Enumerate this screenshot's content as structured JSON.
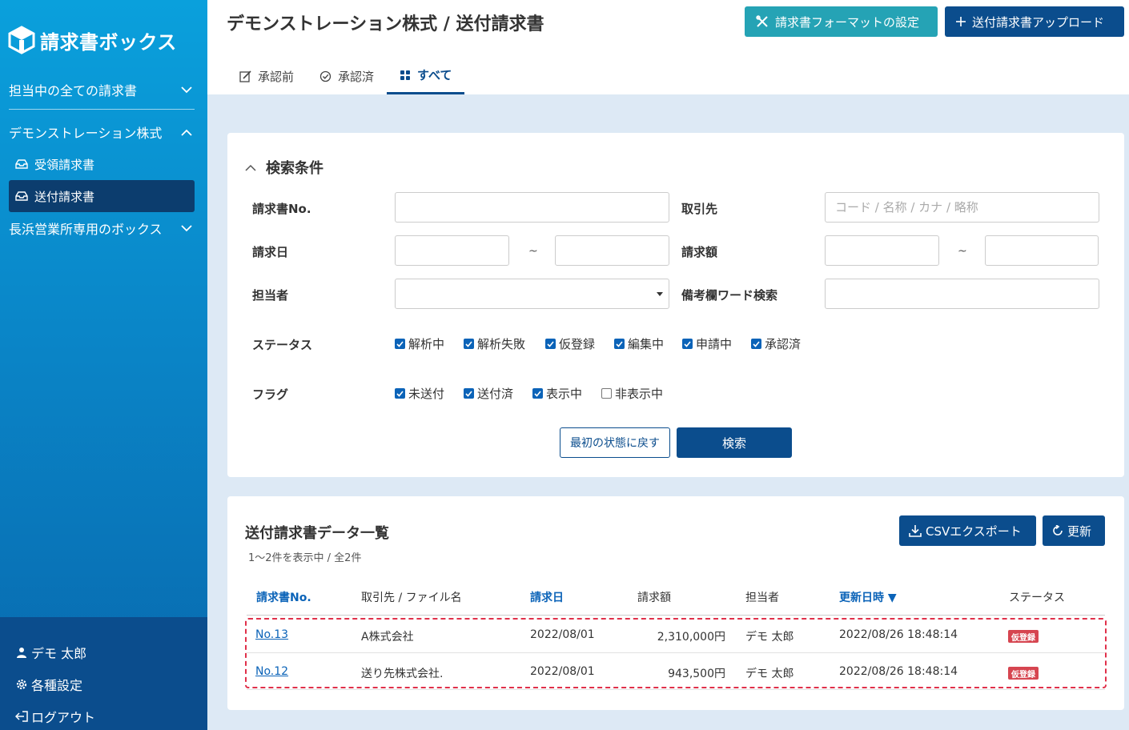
{
  "app": {
    "logo_text": "請求書ボックス"
  },
  "sidebar": {
    "all_invoices": "担当中の全ての請求書",
    "company": "デモンストレーション株式",
    "received": "受領請求書",
    "sent": "送付請求書",
    "nagahama": "長浜営業所専用のボックス",
    "user": "デモ 太郎",
    "settings": "各種設定",
    "logout": "ログアウト"
  },
  "header": {
    "title": "デモンストレーション株式 / 送付請求書",
    "format_button": "請求書フォーマットの設定",
    "upload_button": "送付請求書アップロード",
    "tabs": [
      "承認前",
      "承認済",
      "すべて"
    ],
    "active_tab": "すべて"
  },
  "search": {
    "title": "検索条件",
    "invoice_no_label": "請求書No.",
    "partner_label": "取引先",
    "partner_placeholder": "コード / 名称 / カナ / 略称",
    "date_label": "請求日",
    "amount_label": "請求額",
    "range_sep": "~",
    "assignee_label": "担当者",
    "memo_label": "備考欄ワード検索",
    "status_label": "ステータス",
    "statuses": [
      {
        "label": "解析中",
        "checked": true
      },
      {
        "label": "解析失敗",
        "checked": true
      },
      {
        "label": "仮登録",
        "checked": true
      },
      {
        "label": "編集中",
        "checked": true
      },
      {
        "label": "申請中",
        "checked": true
      },
      {
        "label": "承認済",
        "checked": true
      }
    ],
    "flag_label": "フラグ",
    "flags": [
      {
        "label": "未送付",
        "checked": true
      },
      {
        "label": "送付済",
        "checked": true
      },
      {
        "label": "表示中",
        "checked": true
      },
      {
        "label": "非表示中",
        "checked": false
      }
    ],
    "reset_button": "最初の状態に戻す",
    "search_button": "検索"
  },
  "list": {
    "title": "送付請求書データ一覧",
    "count_text": "1〜2件を表示中 / 全2件",
    "csv_button": "CSVエクスポート",
    "refresh_button": "更新",
    "columns": [
      "請求書No.",
      "取引先 / ファイル名",
      "請求日",
      "請求額",
      "担当者",
      "更新日時 ▼",
      "ステータス"
    ],
    "rows": [
      {
        "no": "No.13",
        "partner": "A株式会社",
        "date": "2022/08/01",
        "amount": "2,310,000円",
        "assignee": "デモ 太郎",
        "updated": "2022/08/26 18:48:14",
        "status": "仮登録"
      },
      {
        "no": "No.12",
        "partner": "送り先株式会社.",
        "date": "2022/08/01",
        "amount": "943,500円",
        "assignee": "デモ 太郎",
        "updated": "2022/08/26 18:48:14",
        "status": "仮登録"
      }
    ]
  },
  "colors": {
    "navy": "#0b4d8d",
    "teal": "#25a3b5",
    "badge": "#d64550",
    "sidebar_top": "#0aa0dc",
    "sidebar_bottom": "#0b4d8d"
  }
}
